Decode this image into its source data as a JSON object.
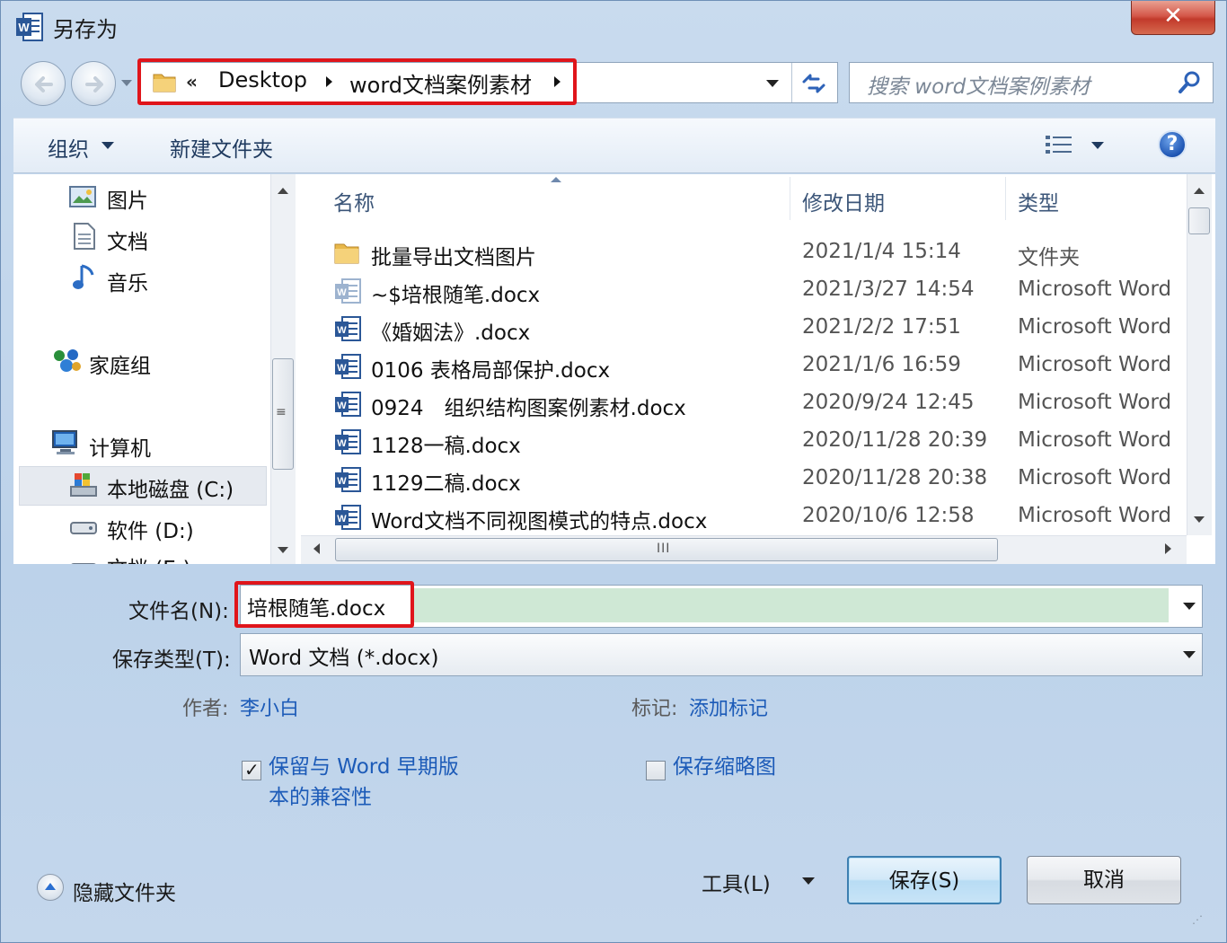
{
  "window": {
    "title": "另存为",
    "close_glyph": "✕",
    "app_icon": "word-app-icon"
  },
  "navigation": {
    "back_icon": "back-arrow-icon",
    "forward_icon": "forward-arrow-icon",
    "breadcrumb_overflow": "«",
    "breadcrumb": [
      "Desktop",
      "word文档案例素材"
    ],
    "search_placeholder": "搜索 word文档案例素材",
    "search_icon": "search-icon",
    "refresh_icon": "refresh-icon"
  },
  "toolbar": {
    "organize_label": "组织",
    "new_folder_label": "新建文件夹",
    "view_icon": "view-details-icon",
    "help_label": "?"
  },
  "sidebar": {
    "items": [
      {
        "label": "图片",
        "icon": "pictures-icon"
      },
      {
        "label": "文档",
        "icon": "documents-icon"
      },
      {
        "label": "音乐",
        "icon": "music-icon"
      },
      {
        "label": "家庭组",
        "icon": "homegroup-icon"
      },
      {
        "label": "计算机",
        "icon": "computer-icon"
      },
      {
        "label": "本地磁盘 (C:)",
        "icon": "local-disk-icon",
        "selected": true
      },
      {
        "label": "软件 (D:)",
        "icon": "drive-icon"
      },
      {
        "label": "文档 (E:)",
        "icon": "drive-icon"
      }
    ]
  },
  "filelist": {
    "columns": [
      "名称",
      "修改日期",
      "类型"
    ],
    "rows": [
      {
        "name": "批量导出文档图片",
        "date": "2021/1/4 15:14",
        "type": "文件夹",
        "icon": "folder-icon"
      },
      {
        "name": "~$培根随笔.docx",
        "date": "2021/3/27 14:54",
        "type": "Microsoft Word",
        "icon": "word-temp-file-icon"
      },
      {
        "name": "《婚姻法》.docx",
        "date": "2021/2/2 17:51",
        "type": "Microsoft Word",
        "icon": "word-file-icon"
      },
      {
        "name": "0106 表格局部保护.docx",
        "date": "2021/1/6 16:59",
        "type": "Microsoft Word",
        "icon": "word-file-icon"
      },
      {
        "name": "0924　组织结构图案例素材.docx",
        "date": "2020/9/24 12:45",
        "type": "Microsoft Word",
        "icon": "word-file-icon"
      },
      {
        "name": "1128一稿.docx",
        "date": "2020/11/28 20:39",
        "type": "Microsoft Word",
        "icon": "word-file-icon"
      },
      {
        "name": "1129二稿.docx",
        "date": "2020/11/28 20:38",
        "type": "Microsoft Word",
        "icon": "word-file-icon"
      },
      {
        "name": "Word文档不同视图模式的特点.docx",
        "date": "2020/10/6 12:58",
        "type": "Microsoft Word",
        "icon": "word-file-icon"
      }
    ],
    "hscroll_grip": "III",
    "vscroll_grip": "≡"
  },
  "form": {
    "filename_label": "文件名(N):",
    "filename_value": "培根随笔.docx",
    "filetype_label": "保存类型(T):",
    "filetype_value": "Word 文档 (*.docx)",
    "author_label": "作者:",
    "author_value": "李小白",
    "tags_label": "标记:",
    "tags_value": "添加标记",
    "compat_label_line1": "保留与 Word 早期版",
    "compat_label_line2": "本的兼容性",
    "compat_checked": true,
    "thumbnail_label": "保存缩略图",
    "thumbnail_checked": false
  },
  "footer": {
    "hide_folders_label": "隐藏文件夹",
    "tools_label": "工具(L)",
    "save_label": "保存(S)",
    "cancel_label": "取消"
  },
  "colors": {
    "highlight_border": "#e0151b",
    "selection_fill": "#cfe8d5",
    "link": "#1c5bb8",
    "word_blue": "#2b5797"
  }
}
